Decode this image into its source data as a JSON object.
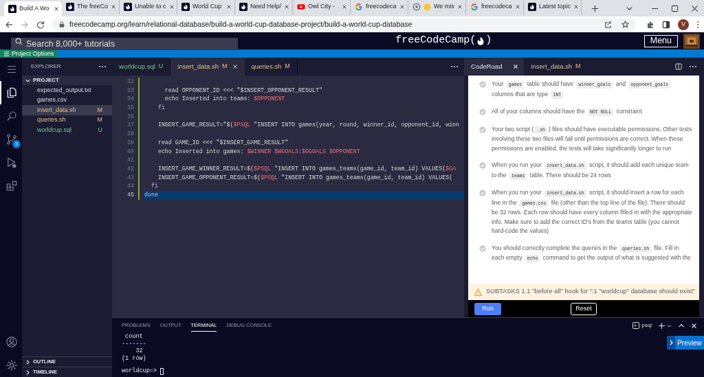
{
  "browser": {
    "tabs": [
      {
        "title": "Build A Wo",
        "kind": "fcc",
        "selected": true
      },
      {
        "title": "The freeCo",
        "kind": "fcc",
        "selected": false
      },
      {
        "title": "Unable to c",
        "kind": "fcc",
        "selected": false
      },
      {
        "title": "World Cup",
        "kind": "fcc",
        "selected": false
      },
      {
        "title": "Need Help/",
        "kind": "fcc",
        "selected": false
      },
      {
        "title": "Owl City - ",
        "kind": "youtube",
        "selected": false
      },
      {
        "title": "freecodeca",
        "kind": "google",
        "selected": false
      },
      {
        "title": "We mis",
        "kind": "ring_emoji",
        "selected": false
      },
      {
        "title": "freecodeca",
        "kind": "google",
        "selected": false
      },
      {
        "title": "Latest topic",
        "kind": "fcc",
        "selected": false
      }
    ],
    "url": "freecodecamp.org/learn/relational-database/build-a-world-cup-database-project/build-a-world-cup-database",
    "profile_initial": "V"
  },
  "site_nav": {
    "search_placeholder": "Search 8,000+ tutorials",
    "logo_parts": [
      "freeCodeCamp(",
      ")"
    ],
    "menu": "Menu"
  },
  "project_options": "Project Options",
  "activity_bar": {
    "top": [
      {
        "kind": "menu",
        "selected": false
      },
      {
        "kind": "files",
        "selected": true
      },
      {
        "kind": "search",
        "selected": false
      },
      {
        "kind": "source_control",
        "selected": false,
        "badge": "3"
      },
      {
        "kind": "run",
        "selected": false
      },
      {
        "kind": "extensions",
        "selected": false
      }
    ],
    "bottom": [
      {
        "kind": "account",
        "selected": false
      },
      {
        "kind": "settings",
        "selected": false
      }
    ]
  },
  "explorer": {
    "title": "EXPLORER",
    "section": "PROJECT",
    "expanded": true,
    "files": [
      {
        "name": "expected_output.txt",
        "kind": "none",
        "selected": false
      },
      {
        "name": "games.csv",
        "kind": "none",
        "selected": false
      },
      {
        "name": "insert_data.sh",
        "kind": "modified",
        "status": "M",
        "selected": true
      },
      {
        "name": "queries.sh",
        "kind": "modified",
        "status": "M",
        "selected": false
      },
      {
        "name": "worldcup.sql",
        "kind": "untracked",
        "status": "U",
        "selected": false
      }
    ],
    "bottom_sections": [
      {
        "label": "OUTLINE",
        "expanded": false
      },
      {
        "label": "TIMELINE",
        "expanded": false
      }
    ]
  },
  "editor": {
    "tabs": [
      {
        "label": "worldcup.sql",
        "status": "U",
        "kind": "untracked",
        "selected": false
      },
      {
        "label": "insert_data.sh",
        "status": "M",
        "kind": "modified",
        "selected": true
      },
      {
        "label": "queries.sh",
        "status": "M",
        "kind": "modified",
        "selected": false
      }
    ],
    "lines": [
      {
        "number": "32",
        "highlighted": false
      },
      {
        "number": "33",
        "highlighted": false,
        "segments": [
          {
            "kind": "plain",
            "text": "      read OPPONENT_ID <<< \"$INSERT_OPPONENT_RESULT\""
          }
        ]
      },
      {
        "number": "34",
        "highlighted": false,
        "segments": [
          {
            "kind": "plain",
            "text": "      echo Inserted into teams: "
          },
          {
            "kind": "var",
            "text": "$OPPONENT"
          }
        ]
      },
      {
        "number": "35",
        "highlighted": false,
        "segments": [
          {
            "kind": "kw",
            "text": "    fi"
          }
        ]
      },
      {
        "number": "36",
        "highlighted": false
      },
      {
        "number": "37",
        "highlighted": false,
        "segments": [
          {
            "kind": "plain",
            "text": "    INSERT_GAME_RESULT=\"$("
          },
          {
            "kind": "var",
            "text": "$PSQL"
          },
          {
            "kind": "plain",
            "text": " \"INSERT INTO games(year, round, winner_id, opponent_id, winn"
          }
        ]
      },
      {
        "number": "38",
        "highlighted": false
      },
      {
        "number": "39",
        "highlighted": false,
        "segments": [
          {
            "kind": "plain",
            "text": "    read GAME_ID <<< \"$INSERT_GAME_RESULT\""
          }
        ]
      },
      {
        "number": "40",
        "highlighted": false,
        "segments": [
          {
            "kind": "plain",
            "text": "    echo Inserted into games: "
          },
          {
            "kind": "var",
            "text": "$WINNER $WGOALS"
          },
          {
            "kind": "plain",
            "text": ":"
          },
          {
            "kind": "var",
            "text": "$OGOALS $OPPONENT"
          }
        ]
      },
      {
        "number": "41",
        "highlighted": false
      },
      {
        "number": "42",
        "highlighted": false,
        "segments": [
          {
            "kind": "plain",
            "text": "    INSERT_GAME_WINNER_RESULT=$("
          },
          {
            "kind": "var",
            "text": "$PSQL"
          },
          {
            "kind": "plain",
            "text": " \"INSERT INTO games_teams(game_id, team_id) VALUES("
          },
          {
            "kind": "var",
            "text": "$GA"
          }
        ]
      },
      {
        "number": "43",
        "highlighted": false,
        "segments": [
          {
            "kind": "plain",
            "text": "    INSERT_GAME_OPPONENT_RESULT=$("
          },
          {
            "kind": "var",
            "text": "$PSQL"
          },
          {
            "kind": "plain",
            "text": " \"INSERT INTO games_teams(game_id, team_id) VALUES("
          }
        ]
      },
      {
        "number": "44",
        "highlighted": false,
        "segments": [
          {
            "kind": "kw",
            "text": "  fi"
          }
        ]
      },
      {
        "number": "45",
        "highlighted": true,
        "segments": [
          {
            "kind": "kw",
            "text": "done"
          }
        ]
      }
    ]
  },
  "coderoad": {
    "tabs": [
      {
        "label": "CodeRoad",
        "selected": true
      },
      {
        "label": "insert_data.sh",
        "status": "M",
        "selected": false
      }
    ],
    "tests": [
      {
        "parts": [
          {
            "kind": "text",
            "text": "Your "
          },
          {
            "kind": "code",
            "text": "games"
          },
          {
            "kind": "text",
            "text": " table should have "
          },
          {
            "kind": "code",
            "text": "winner_goals"
          },
          {
            "kind": "text",
            "text": " and "
          },
          {
            "kind": "code",
            "text": "opponent_goals"
          },
          {
            "kind": "text",
            "text": " columns that are type "
          },
          {
            "kind": "code",
            "text": "INT"
          }
        ]
      },
      {
        "parts": [
          {
            "kind": "text",
            "text": "All of your columns should have the "
          },
          {
            "kind": "code",
            "text": "NOT NULL"
          },
          {
            "kind": "text",
            "text": " constraint"
          }
        ]
      },
      {
        "parts": [
          {
            "kind": "text",
            "text": "Your two script ("
          },
          {
            "kind": "code",
            "text": ".sh"
          },
          {
            "kind": "text",
            "text": ") files should have executable permissions. Other tests involving these two files will fail until permissions are correct. When these permissions are enabled, the tests will take significantly longer to run"
          }
        ]
      },
      {
        "parts": [
          {
            "kind": "text",
            "text": "When you run your "
          },
          {
            "kind": "code",
            "text": "insert_data.sh"
          },
          {
            "kind": "text",
            "text": " script, it should add each unique team to the "
          },
          {
            "kind": "code",
            "text": "teams"
          },
          {
            "kind": "text",
            "text": " table. There should be 24 rows"
          }
        ]
      },
      {
        "parts": [
          {
            "kind": "text",
            "text": "When you run your "
          },
          {
            "kind": "code",
            "text": "insert_data.sh"
          },
          {
            "kind": "text",
            "text": " script, it should insert a row for each line in the "
          },
          {
            "kind": "code",
            "text": "games.csv"
          },
          {
            "kind": "text",
            "text": " file (other than the top line of the file). There should be 32 rows. Each row should have every column filled in with the appropriate info. Make sure to add the correct ID's from the teams table (you cannot hard-code the values)"
          }
        ]
      },
      {
        "parts": [
          {
            "kind": "text",
            "text": "You should correctly complete the queries in the "
          },
          {
            "kind": "code",
            "text": "queries.sh"
          },
          {
            "kind": "text",
            "text": " file. Fill in each empty "
          },
          {
            "kind": "code",
            "text": "echo"
          },
          {
            "kind": "text",
            "text": " command to get the output of what is suggested with the"
          }
        ]
      }
    ],
    "warning": "SUBTASKS 1.1 \"before all\" hook for \":1 \"worldcup\" database should exist\"",
    "buttons": [
      "Run",
      "Reset"
    ]
  },
  "panel": {
    "tabs": [
      {
        "label": "PROBLEMS",
        "selected": false
      },
      {
        "label": "OUTPUT",
        "selected": false
      },
      {
        "label": "TERMINAL",
        "selected": true
      },
      {
        "label": "DEBUG CONSOLE",
        "selected": false
      }
    ],
    "terminal_name": "psql",
    "output": [
      " count",
      "-------",
      "    32",
      "(1 row)"
    ],
    "prompt": "worldcup=> "
  },
  "preview_button": "Preview"
}
